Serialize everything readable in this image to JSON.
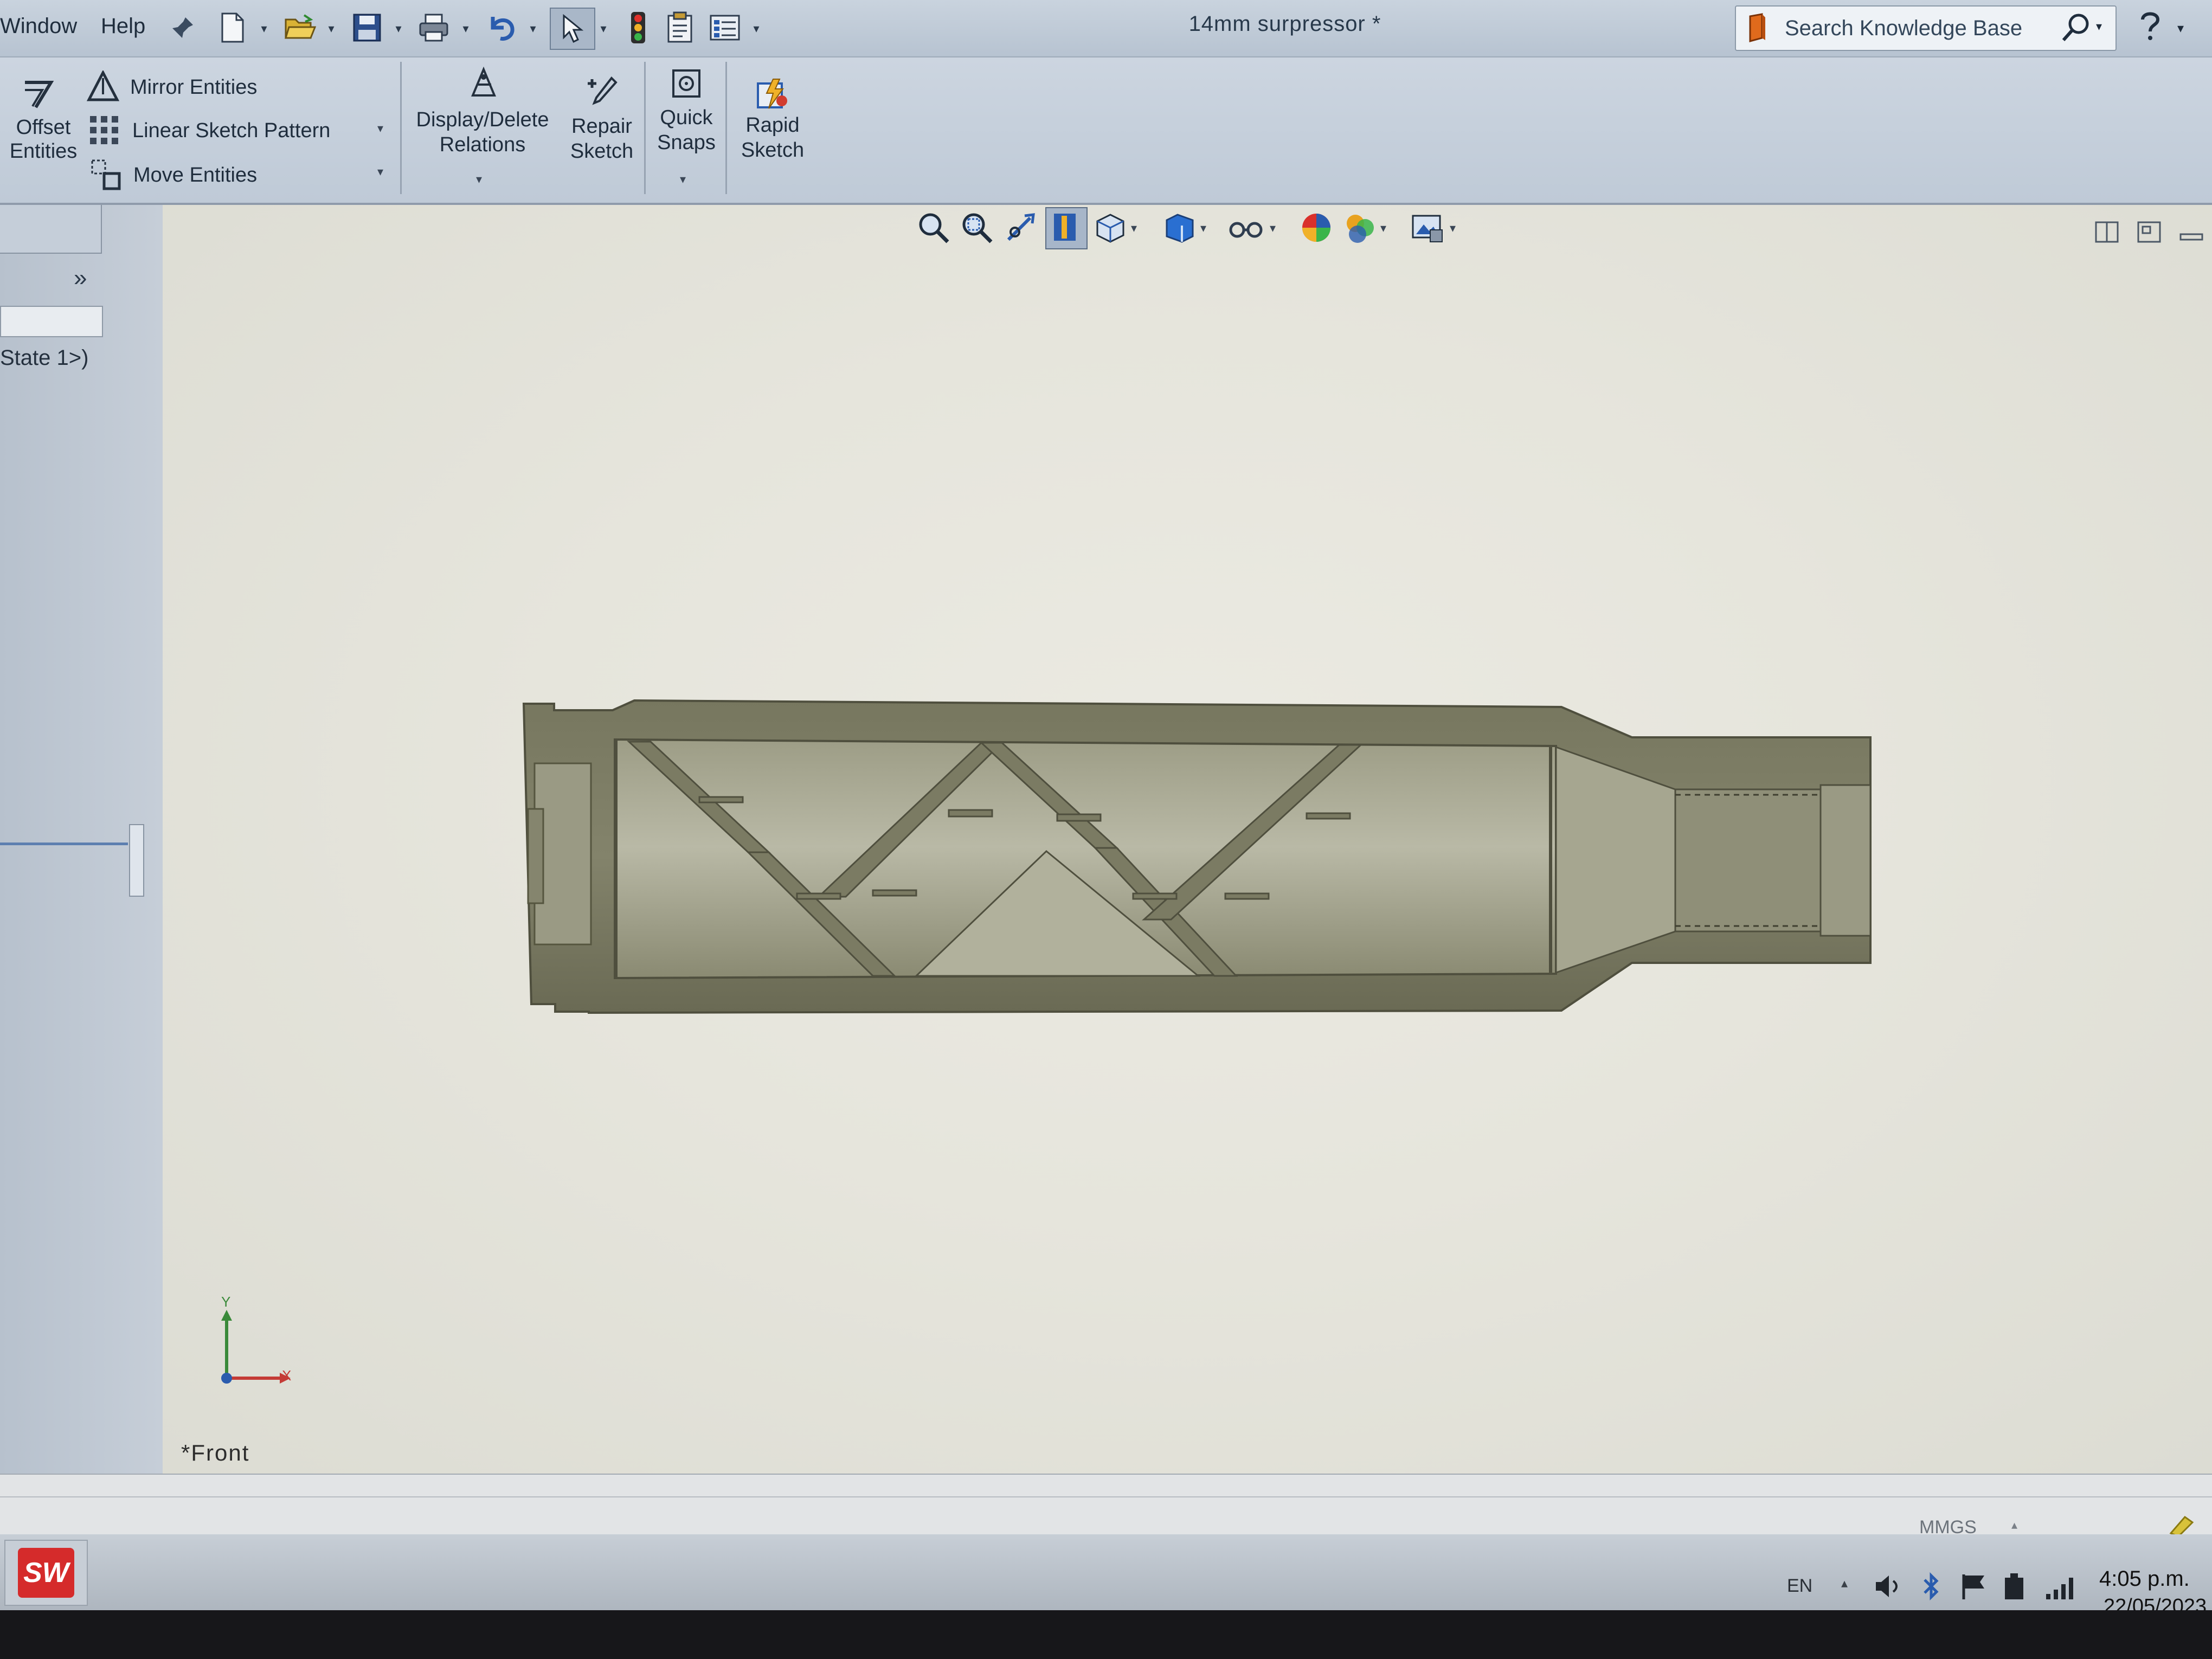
{
  "menu": {
    "window": "Window",
    "help": "Help"
  },
  "document": {
    "title": "14mm surpressor *"
  },
  "search": {
    "placeholder": "Search Knowledge Base"
  },
  "ribbon": {
    "offset_entities": [
      "Offset",
      "Entities"
    ],
    "mirror_entities": "Mirror Entities",
    "linear_sketch_pattern": "Linear Sketch Pattern",
    "move_entities": "Move Entities",
    "display_delete_relations": [
      "Display/Delete",
      "Relations"
    ],
    "repair_sketch": [
      "Repair",
      "Sketch"
    ],
    "quick_snaps": [
      "Quick",
      "Snaps"
    ],
    "rapid_sketch": [
      "Rapid",
      "Sketch"
    ]
  },
  "panel": {
    "state_text": "State 1>)"
  },
  "graphics": {
    "view_name": "*Front",
    "triad_y": "Y",
    "triad_x": "X",
    "model_fill": "#6f6f5a",
    "model_chamber": "#b8b8a3"
  },
  "status": {
    "units": "MMGS"
  },
  "taskbar": {
    "app_logo": "SW",
    "language": "EN",
    "time": "4:05 p.m.",
    "date": "22/05/2023"
  },
  "colors": {
    "ribbon_bg": "#c4cfdb",
    "viewport_bg": "#e8e7de",
    "accent_blue": "#2a5cae"
  }
}
